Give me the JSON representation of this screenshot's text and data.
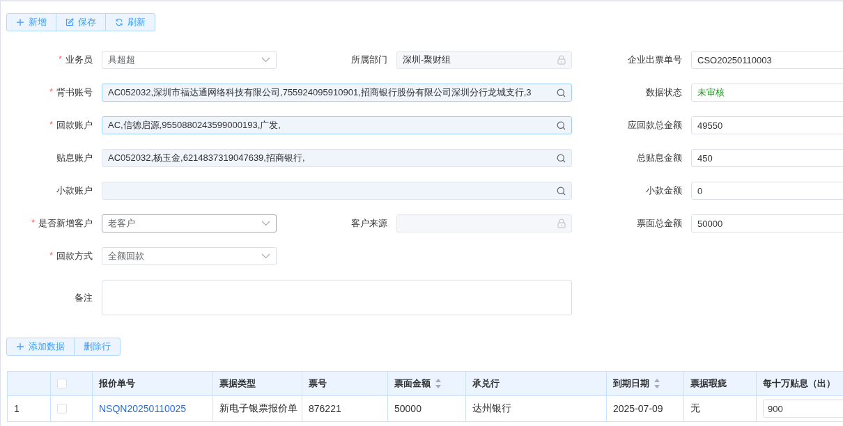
{
  "toolbar": [
    {
      "label": "新增",
      "kind": "plus"
    },
    {
      "label": "保存",
      "kind": "edit"
    },
    {
      "label": "刷新",
      "kind": "refresh"
    }
  ],
  "form_rows": [
    [
      {
        "label": "业务员",
        "required_mark": "*",
        "kind": "select",
        "value": "具超超"
      },
      {
        "label": "所属部门",
        "kind": "locked",
        "value": "深圳-聚财组"
      },
      {
        "label": "企业出票单号",
        "kind": "text",
        "value": "CSO20250110003"
      }
    ],
    [
      {
        "label": "背书账号",
        "required_mark": "*",
        "kind": "search",
        "highlighted": true,
        "value": "AC052032,深圳市福达通网络科技有限公司,755924095910901,招商银行股份有限公司深圳分行龙城支行,3"
      },
      {
        "label": "数据状态",
        "kind": "status",
        "value": "未审核",
        "color": "#1a9a1a"
      }
    ],
    [
      {
        "label": "回款账户",
        "required_mark": "*",
        "kind": "search",
        "highlighted": true,
        "value": "AC,信德启源,9550880243599000193,广发,"
      },
      {
        "label": "应回款总金额",
        "kind": "text",
        "value": "49550"
      }
    ],
    [
      {
        "label": "贴息账户",
        "kind": "search",
        "highlighted": false,
        "value": "AC052032,杨玉金,6214837319047639,招商银行,"
      },
      {
        "label": "总贴息金额",
        "kind": "text",
        "value": "450"
      }
    ],
    [
      {
        "label": "小款账户",
        "kind": "search",
        "highlighted": false
      },
      {
        "label": "小款金额",
        "kind": "text",
        "value": "0"
      }
    ],
    [
      {
        "label": "是否新增客户",
        "required_mark": "*",
        "kind": "select",
        "value": "老客户"
      },
      {
        "label": "客户来源",
        "kind": "locked"
      },
      {
        "label": "票面总金额",
        "kind": "text",
        "value": "50000"
      }
    ],
    [
      {
        "label": "回款方式",
        "required_mark": "*",
        "kind": "select",
        "value": "全额回款"
      }
    ],
    [
      {
        "label": "备注",
        "kind": "textarea"
      }
    ]
  ],
  "table_toolbar": [
    {
      "label": "添加数据",
      "kind": "plus"
    },
    {
      "label": "删除行",
      "kind": "plain"
    }
  ],
  "table": {
    "columns": [
      {
        "kind": "index"
      },
      {
        "kind": "checkbox",
        "checked": false
      },
      {
        "label": "报价单号",
        "sortable": false
      },
      {
        "label": "票据类型",
        "sortable": false
      },
      {
        "label": "票号",
        "sortable": false
      },
      {
        "label": "票面金额",
        "sortable": true
      },
      {
        "label": "承兑行",
        "sortable": false
      },
      {
        "label": "到期日期",
        "sortable": true
      },
      {
        "label": "票据瑕疵",
        "sortable": false
      },
      {
        "label": "每十万贴息（出）",
        "sortable": false
      }
    ],
    "rows": [
      {
        "index": "1",
        "checked": false,
        "quote_no": "NSQN20250110025",
        "bill_type": "新电子银票报价单",
        "bill_no": "876221",
        "face_amount": "50000",
        "acceptor": "达州银行",
        "due_date": "2025-07-09",
        "defect": "无",
        "discount_per_100k": "900"
      }
    ]
  }
}
